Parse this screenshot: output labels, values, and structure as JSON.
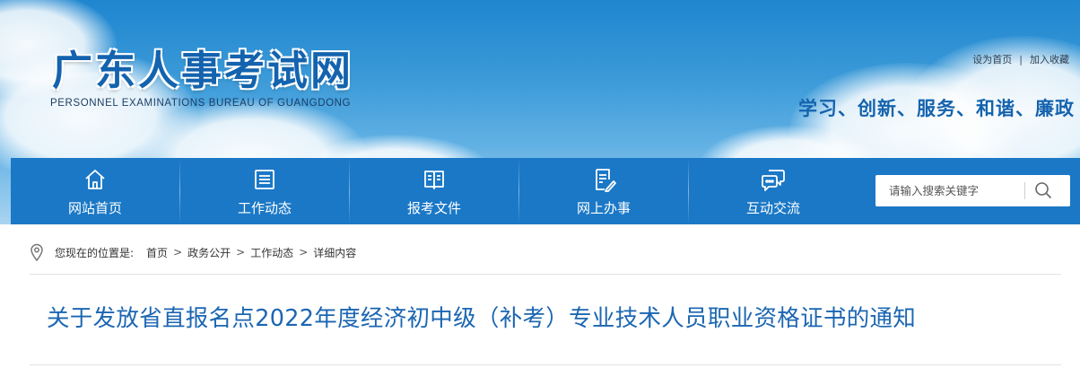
{
  "site": {
    "title_cn": "广东人事考试网",
    "title_en": "PERSONNEL EXAMINATIONS BUREAU OF GUANGDONG",
    "slogan": "学习、创新、服务、和谐、廉政"
  },
  "top_links": {
    "set_homepage": "设为首页",
    "separator": "|",
    "add_favorite": "加入收藏"
  },
  "nav": {
    "items": [
      {
        "label": "网站首页",
        "icon": "home-icon"
      },
      {
        "label": "工作动态",
        "icon": "news-list-icon"
      },
      {
        "label": "报考文件",
        "icon": "open-book-icon"
      },
      {
        "label": "网上办事",
        "icon": "edit-document-icon"
      },
      {
        "label": "互动交流",
        "icon": "chat-bubbles-icon"
      }
    ],
    "search_placeholder": "请输入搜索关键字",
    "search_icon": "search-icon"
  },
  "breadcrumb": {
    "prefix": "您现在的位置是:",
    "items": [
      "首页",
      "政务公开",
      "工作动态",
      "详细内容"
    ],
    "separator": ">",
    "icon": "location-pin-icon"
  },
  "article": {
    "title": "关于发放省直报名点2022年度经济初中级（补考）专业技术人员职业资格证书的通知"
  },
  "colors": {
    "nav_bg": "#1b78c6",
    "title_blue": "#1b66b2",
    "logo_blue": "#1463ae"
  }
}
